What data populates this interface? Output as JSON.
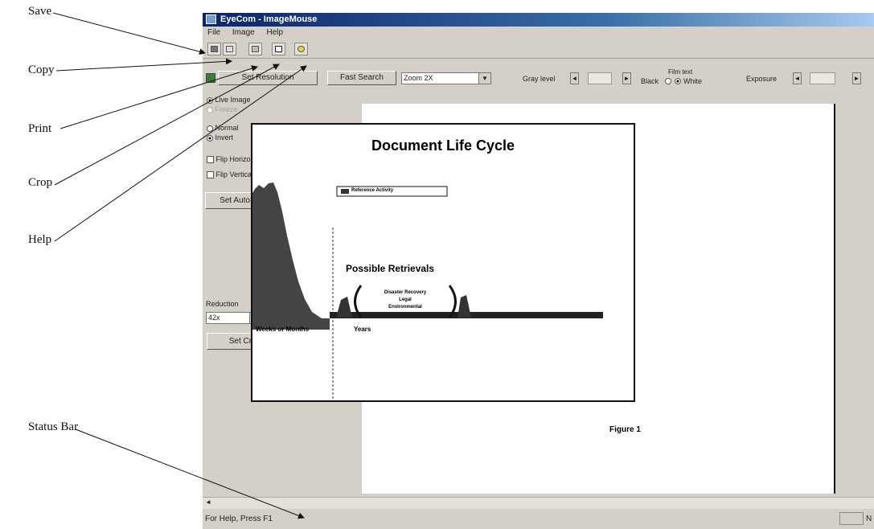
{
  "callouts": {
    "save": "Save",
    "copy": "Copy",
    "print": "Print",
    "crop": "Crop",
    "help": "Help",
    "status_bar": "Status Bar"
  },
  "window": {
    "title": "EyeCom - ImageMouse",
    "menu": [
      "File",
      "Image",
      "Help"
    ]
  },
  "toolbar_icons": [
    "save-icon",
    "copy-icon",
    "print-icon",
    "crop-icon",
    "help-icon"
  ],
  "controls": {
    "set_resolution": "Set Resolution",
    "fast_search": "Fast Search",
    "zoom_value": "Zoom 2X",
    "gray_level": "Gray level",
    "black": "Black",
    "film_text": "Film text",
    "white": "White",
    "exposure": "Exposure"
  },
  "panel": {
    "live_image": "Live Image",
    "freeze": "Freeze",
    "normal": "Normal",
    "invert": "Invert",
    "flip_horizontal": "Flip Horizontal",
    "flip_vertical": "Flip Vertical",
    "set_autosave": "Set AutoSave",
    "reduction": "Reduction",
    "reduction_value": "42x",
    "set_crop": "Set Crop"
  },
  "figure": {
    "title": "Document Life Cycle",
    "legend": "Reference Activity",
    "possible_retrievals": "Possible Retrievals",
    "retrieval_lines": [
      "Disaster Recovery",
      "Legal",
      "Environmental"
    ],
    "weeks_or_months": "Weeks or Months",
    "years": "Years",
    "caption": "Figure 1"
  },
  "status": {
    "help_text": "For Help, Press F1",
    "right_indicator": "N"
  }
}
